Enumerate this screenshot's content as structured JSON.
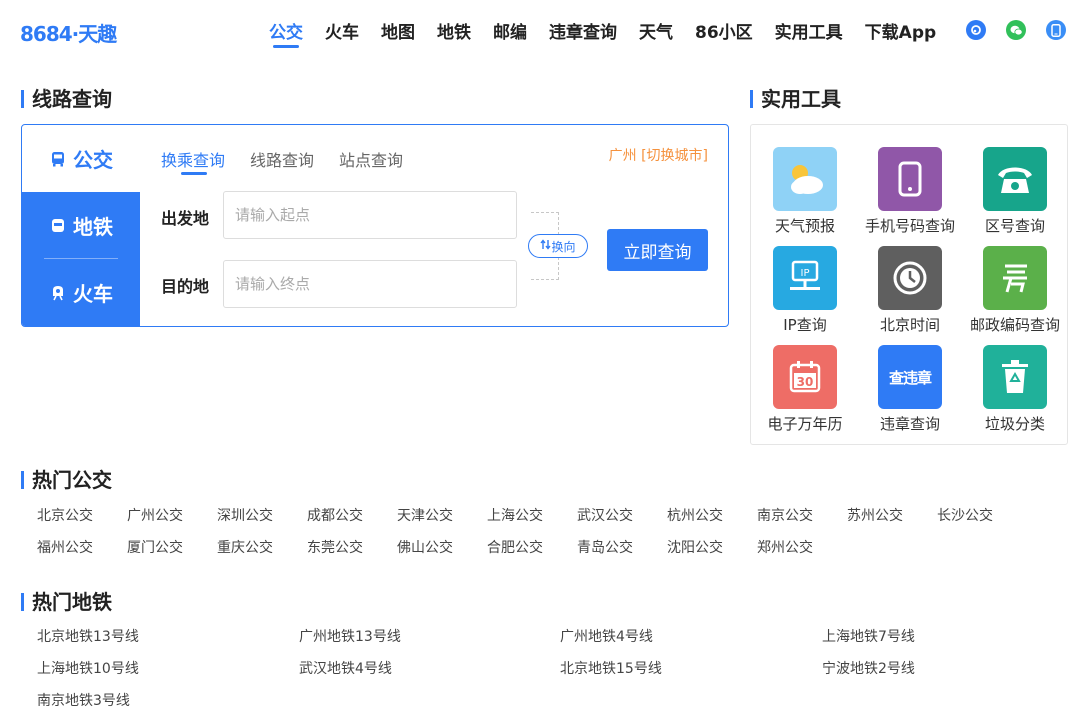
{
  "header": {
    "logo": "8684·天趣",
    "nav": [
      "公交",
      "火车",
      "地图",
      "地铁",
      "邮编",
      "违章查询",
      "天气",
      "86小区",
      "实用工具",
      "下载App"
    ]
  },
  "route_section": {
    "title": "线路查询",
    "side_tabs": [
      "公交",
      "地铁",
      "火车"
    ],
    "sub_tabs": [
      "换乘查询",
      "线路查询",
      "站点查询"
    ],
    "city": "广州 [切换城市]",
    "from_label": "出发地",
    "from_placeholder": "请输入起点",
    "to_label": "目的地",
    "to_placeholder": "请输入终点",
    "swap_label": "换向",
    "search_button": "立即查询"
  },
  "tools_section": {
    "title": "实用工具",
    "items": [
      {
        "label": "天气预报",
        "icon": "weather-icon",
        "color": "#7cc7f5"
      },
      {
        "label": "手机号码查询",
        "icon": "phone-icon",
        "color": "#9057a8"
      },
      {
        "label": "区号查询",
        "icon": "telephone-icon",
        "color": "#17a58b"
      },
      {
        "label": "IP查询",
        "icon": "ip-icon",
        "color": "#27a9e1"
      },
      {
        "label": "北京时间",
        "icon": "clock-icon",
        "color": "#5f5f5f"
      },
      {
        "label": "邮政编码查询",
        "icon": "post-icon",
        "color": "#5bb04a"
      },
      {
        "label": "电子万年历",
        "icon": "calendar-icon",
        "color": "#ee6d66"
      },
      {
        "label": "违章查询",
        "icon": "violation-icon",
        "color": "#2f7bf5"
      },
      {
        "label": "垃圾分类",
        "icon": "trash-icon",
        "color": "#20b19a"
      }
    ],
    "calendar_number": "30",
    "violation_text": "查违章"
  },
  "hot_bus": {
    "title": "热门公交",
    "links": [
      "北京公交",
      "广州公交",
      "深圳公交",
      "成都公交",
      "天津公交",
      "上海公交",
      "武汉公交",
      "杭州公交",
      "南京公交",
      "苏州公交",
      "长沙公交",
      "福州公交",
      "厦门公交",
      "重庆公交",
      "东莞公交",
      "佛山公交",
      "合肥公交",
      "青岛公交",
      "沈阳公交",
      "郑州公交"
    ]
  },
  "hot_metro": {
    "title": "热门地铁",
    "links": [
      "北京地铁13号线",
      "广州地铁13号线",
      "广州地铁4号线",
      "上海地铁7号线",
      "上海地铁10号线",
      "武汉地铁4号线",
      "北京地铁15号线",
      "宁波地铁2号线",
      "南京地铁3号线"
    ]
  }
}
